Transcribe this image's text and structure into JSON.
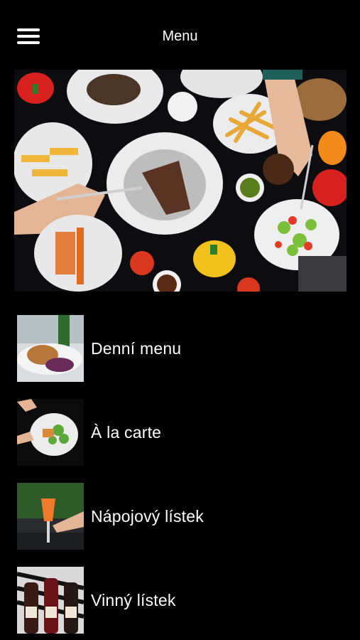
{
  "header": {
    "title": "Menu",
    "menu_icon": "hamburger-icon"
  },
  "hero": {
    "image": "food-spread-photo"
  },
  "menu_items": [
    {
      "label": "Denní menu",
      "thumb": "daily-menu-photo"
    },
    {
      "label": "À la carte",
      "thumb": "a-la-carte-photo"
    },
    {
      "label": "Nápojový lístek",
      "thumb": "drinks-photo"
    },
    {
      "label": "Vinný lístek",
      "thumb": "wine-photo"
    }
  ]
}
